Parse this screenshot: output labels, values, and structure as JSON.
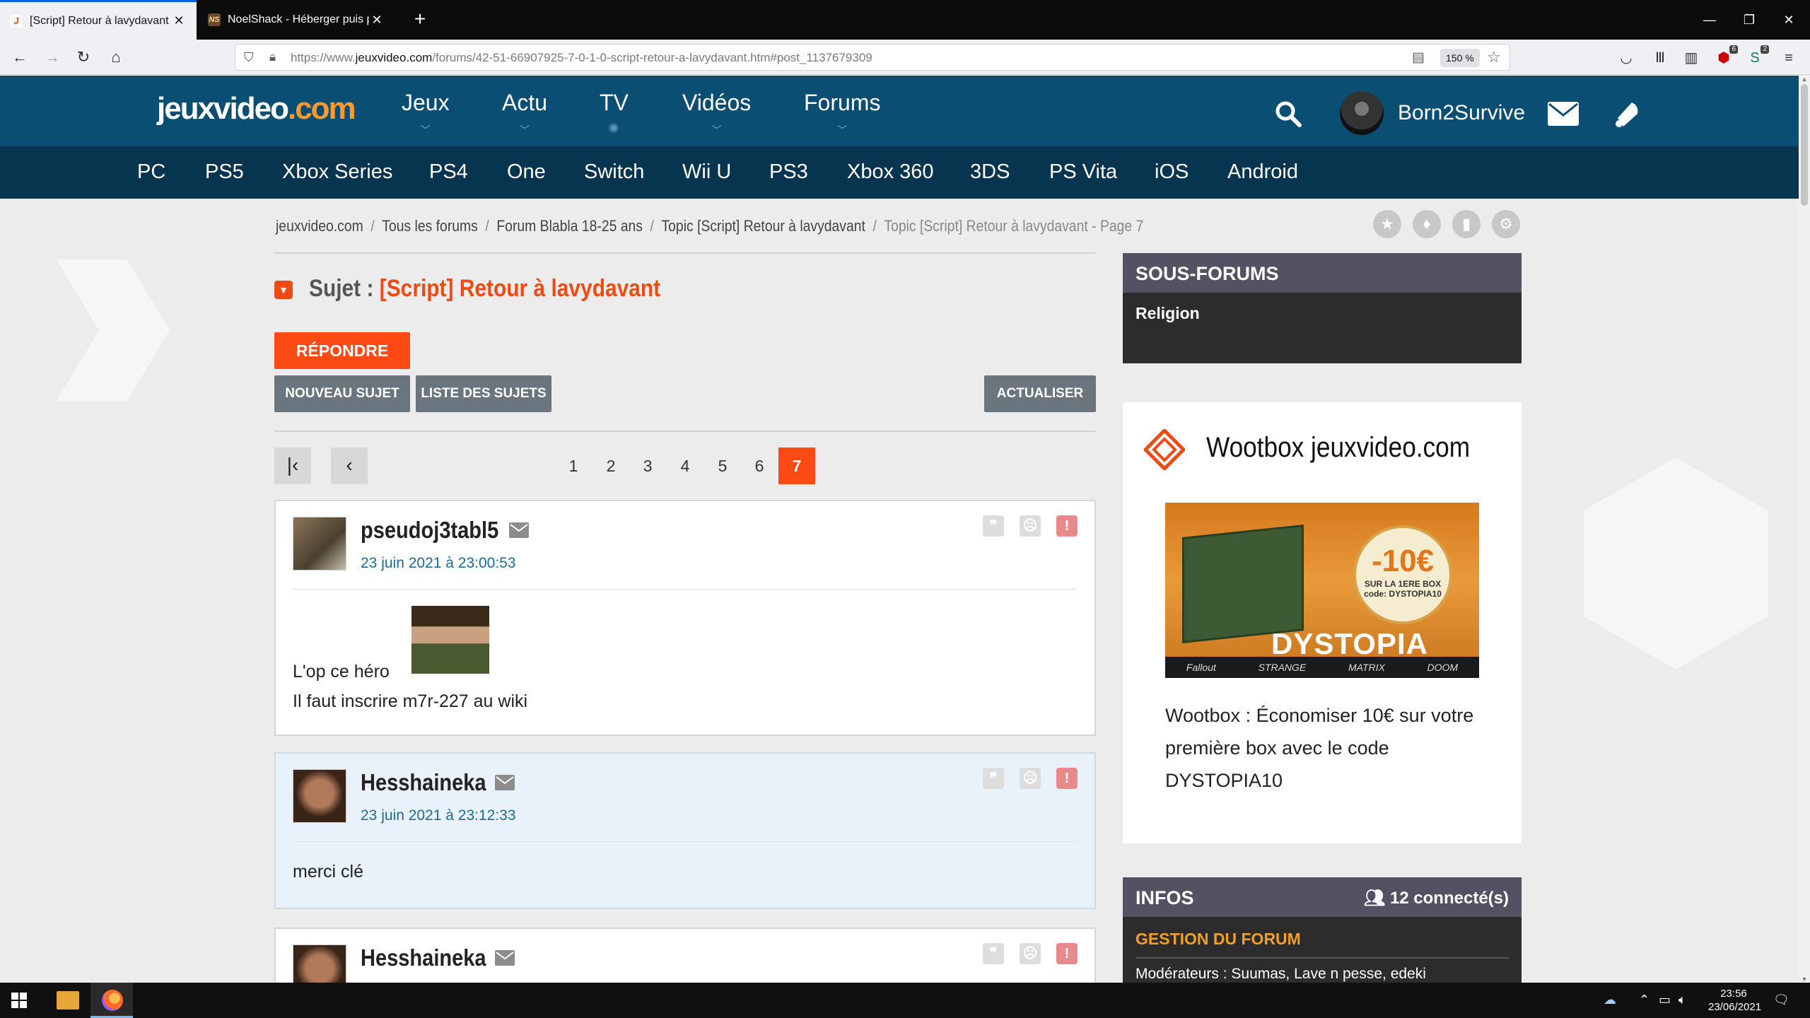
{
  "browser": {
    "tabs": [
      {
        "title": "[Script] Retour à lavydavant sur",
        "favicon": "jv-logo-icon",
        "active": true
      },
      {
        "title": "NoelShack - Héberger puis par",
        "favicon": "noelshack-icon",
        "active": false
      }
    ],
    "url_prefix": "https://www.",
    "url_domain": "jeuxvideo.com",
    "url_path": "/forums/42-51-66907925-7-0-1-0-script-retour-a-lavydavant.htm#post_1137679309",
    "zoom": "150 %",
    "extension_badges": [
      "6",
      "2"
    ]
  },
  "site": {
    "logo_main": "jeuxvideo",
    "logo_tld": ".com",
    "nav": [
      "Jeux",
      "Actu",
      "TV",
      "Vidéos",
      "Forums"
    ],
    "username": "Born2Survive",
    "platforms": [
      "PC",
      "PS5",
      "Xbox Series",
      "PS4",
      "One",
      "Switch",
      "Wii U",
      "PS3",
      "Xbox 360",
      "3DS",
      "PS Vita",
      "iOS",
      "Android"
    ],
    "colors": {
      "header": "#0b4e73",
      "platform_bar": "#07344f",
      "accent": "#fd4a14",
      "date_link": "#1a6b9b"
    }
  },
  "breadcrumb": [
    "jeuxvideo.com",
    "Tous les forums",
    "Forum Blabla 18-25 ans",
    "Topic [Script] Retour à lavydavant",
    "Topic [Script] Retour à lavydavant - Page 7"
  ],
  "topic": {
    "subject_label": "Sujet :",
    "subject_title": "[Script] Retour à lavydavant",
    "reply_label": "RÉPONDRE",
    "new_topic_label": "NOUVEAU SUJET",
    "list_label": "LISTE DES SUJETS",
    "refresh_label": "ACTUALISER",
    "pages": [
      "1",
      "2",
      "3",
      "4",
      "5",
      "6",
      "7"
    ],
    "current_page": "7"
  },
  "posts": [
    {
      "author": "pseudoj3tabl5",
      "date": "23 juin 2021 à 23:00:53",
      "lines": [
        "L'op ce héro",
        "Il faut inscrire m7r-227 au wiki"
      ]
    },
    {
      "author": "Hesshaineka",
      "date": "23 juin 2021 à 23:12:33",
      "lines": [
        "merci clé"
      ]
    },
    {
      "author": "Hesshaineka"
    }
  ],
  "sidebar": {
    "sous_forums_title": "SOUS-FORUMS",
    "sous_forums": [
      "Religion"
    ],
    "wootbox_title": "Wootbox jeuxvideo.com",
    "wootbox_badge": "-10€",
    "wootbox_badge_sub": "SUR LA 1ERE BOX",
    "wootbox_badge_code": "code: DYSTOPIA10",
    "wootbox_banner_word": "DYSTOPIA",
    "wootbox_brands": [
      "Fallout",
      "STRANGE",
      "MATRIX",
      "DOOM"
    ],
    "wootbox_text": "Wootbox : Économiser 10€ sur votre première box avec le code DYSTOPIA10",
    "infos_title": "INFOS",
    "connected": "12 connecté(s)",
    "gestion_title": "GESTION DU FORUM",
    "moderators": "Modérateurs : Suumas, Lave n pesse, edeki"
  },
  "taskbar": {
    "time": "23:56",
    "date": "23/06/2021"
  }
}
